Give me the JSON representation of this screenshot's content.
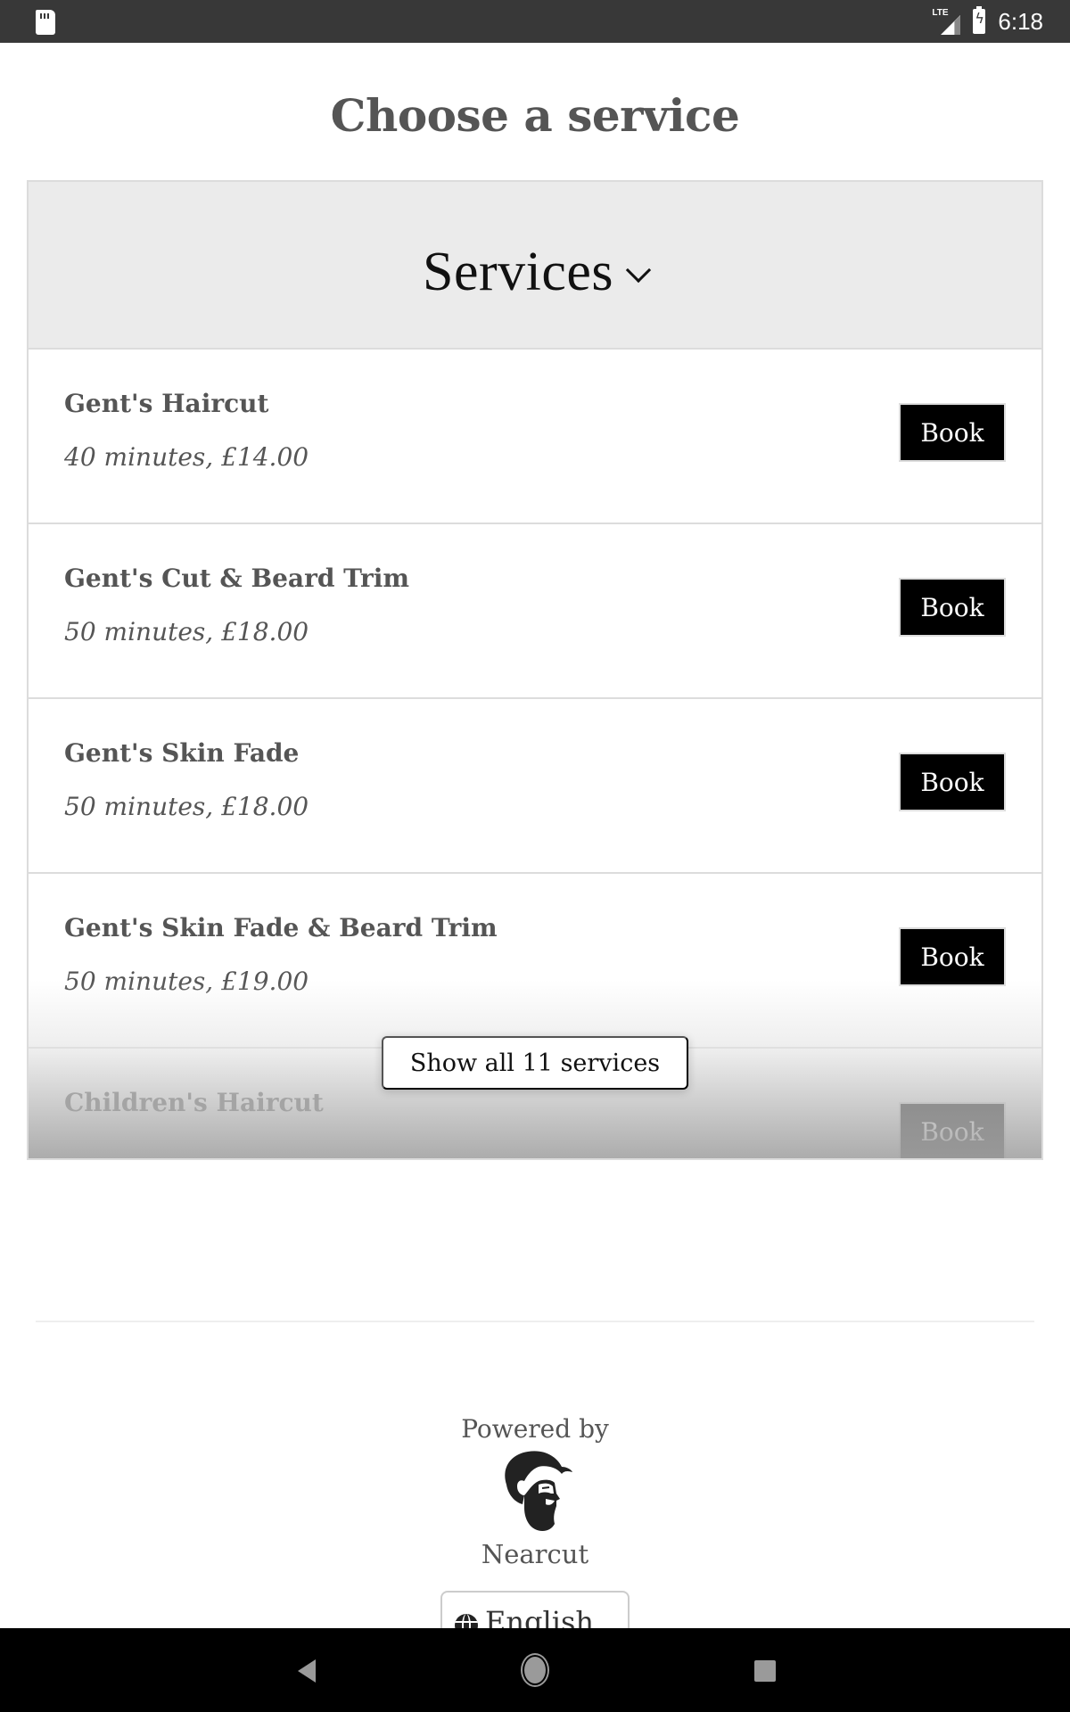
{
  "status_bar": {
    "time": "6:18",
    "network": "LTE",
    "icons": [
      "sd-card-icon",
      "lte-signal-icon",
      "battery-charging-icon"
    ]
  },
  "page": {
    "title": "Choose a service"
  },
  "services_card": {
    "header_title": "Services",
    "header_icon": "chevron-down-icon",
    "book_label": "Book",
    "services": [
      {
        "name": "Gent's Haircut",
        "meta": "40 minutes, £14.00"
      },
      {
        "name": "Gent's Cut & Beard Trim",
        "meta": "50 minutes, £18.00"
      },
      {
        "name": "Gent's Skin Fade",
        "meta": "50 minutes, £18.00"
      },
      {
        "name": "Gent's Skin Fade & Beard Trim",
        "meta": "50 minutes, £19.00"
      },
      {
        "name": "Children's Haircut",
        "meta": ""
      }
    ],
    "show_all_label": "Show all 11 services"
  },
  "footer": {
    "powered_by": "Powered by",
    "brand_name": "Nearcut",
    "language": {
      "selected": "English",
      "icon": "globe-icon"
    }
  },
  "nav_bar": {
    "buttons": [
      "back",
      "home",
      "recents"
    ]
  }
}
